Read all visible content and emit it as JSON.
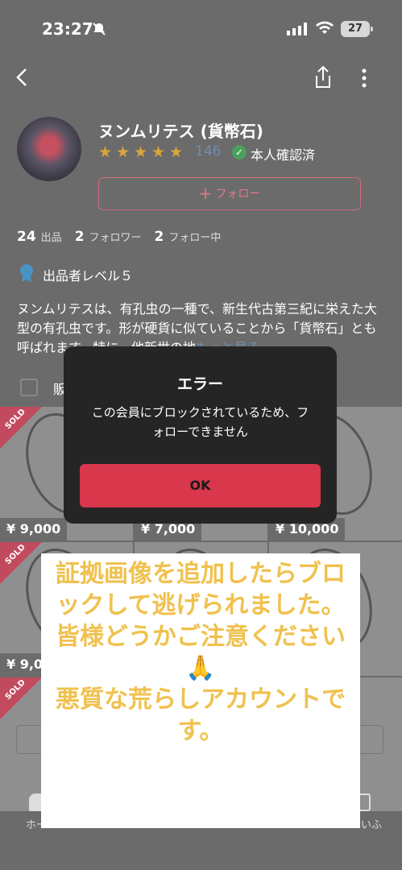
{
  "status_bar": {
    "time": "23:27",
    "battery": "27"
  },
  "profile": {
    "name": "ヌンムリテス (貨幣石)",
    "rating_count": "146",
    "verified_label": "本人確認済",
    "follow_button": "フォロー",
    "counts": [
      {
        "value": "24",
        "label": "出品"
      },
      {
        "value": "2",
        "label": "フォロワー"
      },
      {
        "value": "2",
        "label": "フォロー中"
      }
    ],
    "level_label": "出品者レベル５",
    "bio": "ヌンムリテスは、有孔虫の一種で、新生代古第三紀に栄えた大型の有孔虫です。形が硬貨に似ていることから「貨幣石」とも呼ばれます。特に、他新世の地",
    "bio_more": "もっと見る"
  },
  "filter": {
    "label": "販"
  },
  "listings": [
    {
      "price": "¥ 9,000",
      "sold": true
    },
    {
      "price": "¥ 7,000",
      "sold": false
    },
    {
      "price": "¥ 10,000",
      "sold": false
    },
    {
      "price": "¥ 9,0",
      "sold": true
    },
    {
      "price": "",
      "sold": false
    },
    {
      "price": "",
      "sold": true
    }
  ],
  "sold_label": "SOLD",
  "nav": {
    "home_label": "ホー",
    "right_label": "いふ"
  },
  "dialog": {
    "title": "エラー",
    "message": "この会員にブロックされているため、フォローできません",
    "ok_button": "OK"
  },
  "caption": {
    "lines": [
      "証拠画像を追加したらブロックして逃げられました。",
      "皆様どうかご注意ください🙏",
      "悪質な荒らしアカウントです。"
    ]
  },
  "colors": {
    "ok_button": "#d8374c",
    "caption_text": "#f0c14e",
    "rating_count": "#6b8fb0"
  }
}
